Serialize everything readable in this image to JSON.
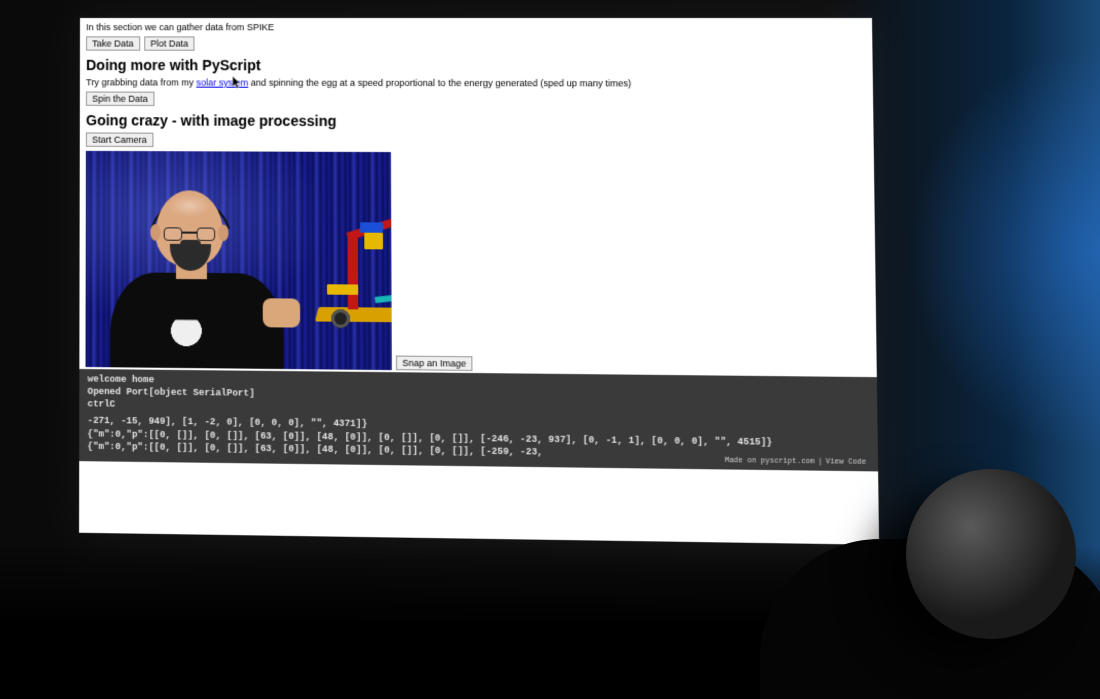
{
  "section_intro": "In this section we can gather data from SPIKE",
  "buttons": {
    "take_data": "Take Data",
    "plot_data": "Plot Data",
    "spin_data": "Spin the Data",
    "start_camera": "Start Camera",
    "snap_image": "Snap an Image"
  },
  "headings": {
    "more_pyscript": "Doing more with PyScript",
    "image_processing": "Going crazy - with image processing"
  },
  "desc_more": {
    "pre": "Try grabbing data from my ",
    "link_text": "solar system",
    "post": " and spinning the egg at a speed proportional to the energy generated (sped up many times)"
  },
  "terminal": {
    "l1": "welcome home",
    "l2": "Opened Port[object SerialPort]",
    "l3": "ctrlC",
    "l4": "-271, -15, 949], [1, -2, 0], [0, 0, 0], \"\", 4371]}",
    "l5": "{\"m\":0,\"p\":[[0, []], [0, []], [63, [0]], [48, [0]], [0, []], [0, []], [-246, -23, 937], [0, -1, 1], [0, 0, 0], \"\", 4515]}",
    "l6": "{\"m\":0,\"p\":[[0, []], [0, []], [63, [0]], [48, [0]], [0, []], [0, []], [-259, -23,"
  },
  "footer": {
    "made_on": "Made on pyscript.com",
    "view_code": "View Code"
  }
}
